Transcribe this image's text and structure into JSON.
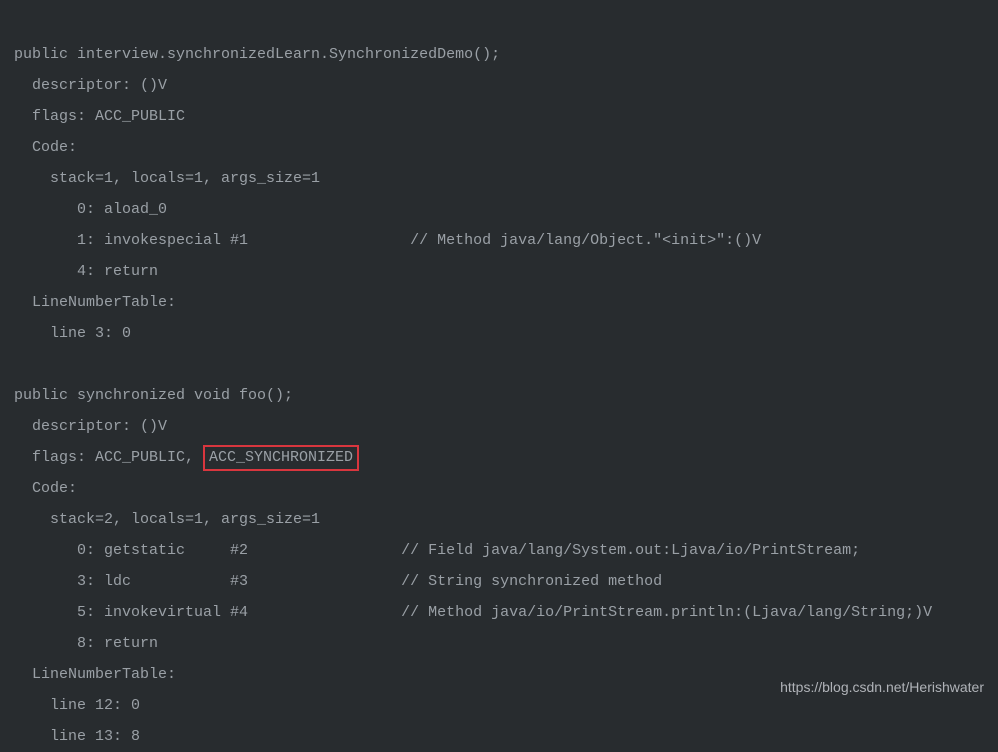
{
  "m1": {
    "sig": "public interview.synchronizedLearn.SynchronizedDemo();",
    "descriptor": "  descriptor: ()V",
    "flags": "  flags: ACC_PUBLIC",
    "codeLabel": "  Code:",
    "stack": "    stack=1, locals=1, args_size=1",
    "bc0": "       0: aload_0",
    "bc1_left": "       1: invokespecial #1",
    "bc1_comment": "// Method java/lang/Object.\"<init>\":()V",
    "bc4": "       4: return",
    "lnt": "  LineNumberTable:",
    "lnt1": "    line 3: 0"
  },
  "m2": {
    "sig": "public synchronized void foo();",
    "descriptor": "  descriptor: ()V",
    "flags_prefix": "  flags: ACC_PUBLIC, ",
    "flags_highlight": "ACC_SYNCHRONIZED",
    "codeLabel": "  Code:",
    "stack": "    stack=2, locals=1, args_size=1",
    "bc0_left": "       0: getstatic     #2",
    "bc0_comment": "// Field java/lang/System.out:Ljava/io/PrintStream;",
    "bc3_left": "       3: ldc           #3",
    "bc3_comment": "// String synchronized method",
    "bc5_left": "       5: invokevirtual #4",
    "bc5_comment": "// Method java/io/PrintStream.println:(Ljava/lang/String;)V",
    "bc8": "       8: return",
    "lnt": "  LineNumberTable:",
    "lnt1": "    line 12: 0",
    "lnt2": "    line 13: 8"
  },
  "spacing": {
    "gap1": "                  ",
    "gap2": "                 "
  },
  "watermark": "https://blog.csdn.net/Herishwater"
}
